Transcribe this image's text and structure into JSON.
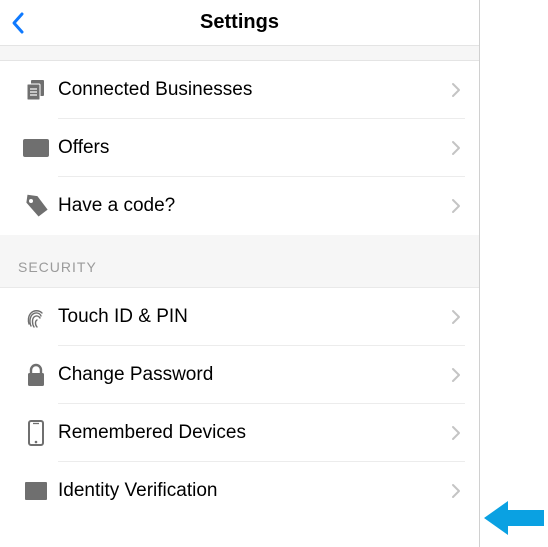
{
  "header": {
    "title": "Settings"
  },
  "group_top": {
    "items": [
      {
        "label": "Connected Businesses"
      },
      {
        "label": "Offers"
      },
      {
        "label": "Have a code?"
      }
    ]
  },
  "section_security": {
    "header": "SECURITY",
    "items": [
      {
        "label": "Touch ID & PIN"
      },
      {
        "label": "Change Password"
      },
      {
        "label": "Remembered Devices"
      },
      {
        "label": "Identity Verification"
      }
    ]
  }
}
